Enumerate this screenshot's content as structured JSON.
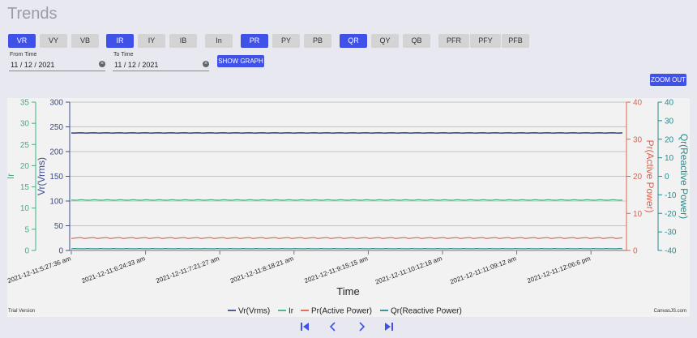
{
  "page": {
    "title": "Trends"
  },
  "toggles": [
    {
      "label": "VR",
      "on": true
    },
    {
      "label": "VY",
      "on": false
    },
    {
      "label": "VB",
      "on": false
    },
    {
      "label": "IR",
      "on": true
    },
    {
      "label": "IY",
      "on": false
    },
    {
      "label": "IB",
      "on": false
    },
    {
      "label": "In",
      "on": false
    },
    {
      "label": "PR",
      "on": true
    },
    {
      "label": "PY",
      "on": false
    },
    {
      "label": "PB",
      "on": false
    },
    {
      "label": "QR",
      "on": true
    },
    {
      "label": "QY",
      "on": false
    },
    {
      "label": "QB",
      "on": false
    },
    {
      "label": "PFR",
      "on": false
    },
    {
      "label": "PFY",
      "on": false
    },
    {
      "label": "PFB",
      "on": false
    }
  ],
  "filters": {
    "from_label": "From Time",
    "from_value": "11 / 12 / 2021",
    "to_label": "To Time",
    "to_value": "11 / 12 / 2021",
    "show_graph": "SHOW GRAPH",
    "zoom_out": "ZOOM OUT"
  },
  "footer": {
    "trial": "Trial Version",
    "credit": "CanvasJS.com"
  },
  "colors": {
    "vr": "#3d4d8a",
    "ir": "#3fb27f",
    "pr": "#e0614c",
    "qr": "#2a8a8c"
  },
  "icons": {
    "first": "first-page-icon",
    "prev": "prev-icon",
    "next": "next-icon",
    "last": "last-page-icon"
  },
  "chart_data": {
    "type": "line",
    "xlabel": "Time",
    "x_ticks": [
      "2021-12-11:5:27:36 am",
      "2021-12-11:6:24:33 am",
      "2021-12-11:7:21:27 am",
      "2021-12-11:8:18:21 am",
      "2021-12-11:9:15:15 am",
      "2021-12-11:10:12:18 am",
      "2021-12-11:11:09:12 am",
      "2021-12-11:12:06:6 pm"
    ],
    "axes": {
      "ir": {
        "label": "Ir",
        "ylim": [
          0,
          35
        ],
        "ticks": [
          0,
          5,
          10,
          15,
          20,
          25,
          30,
          35
        ]
      },
      "vr": {
        "label": "Vr(Vrms)",
        "ylim": [
          0,
          300
        ],
        "ticks": [
          0,
          50,
          100,
          150,
          200,
          250,
          300
        ]
      },
      "pr": {
        "label": "Pr(Active Power)",
        "ylim": [
          0,
          40
        ],
        "ticks": [
          0,
          10,
          20,
          30,
          40
        ]
      },
      "qr": {
        "label": "Qr(Reactive Power)",
        "ylim": [
          -40,
          40
        ],
        "ticks": [
          -40,
          -30,
          -20,
          -10,
          0,
          10,
          20,
          30,
          40
        ]
      }
    },
    "series": [
      {
        "name": "Vr(Vrms)",
        "axis": "vr",
        "approx_value": 237
      },
      {
        "name": "Ir",
        "axis": "ir",
        "approx_value": 12
      },
      {
        "name": "Pr(Active Power)",
        "axis": "pr",
        "approx_value": 3.3
      },
      {
        "name": "Qr(Reactive Power)",
        "axis": "qr",
        "approx_value": -39
      }
    ],
    "grid": true,
    "legend_position": "bottom"
  }
}
